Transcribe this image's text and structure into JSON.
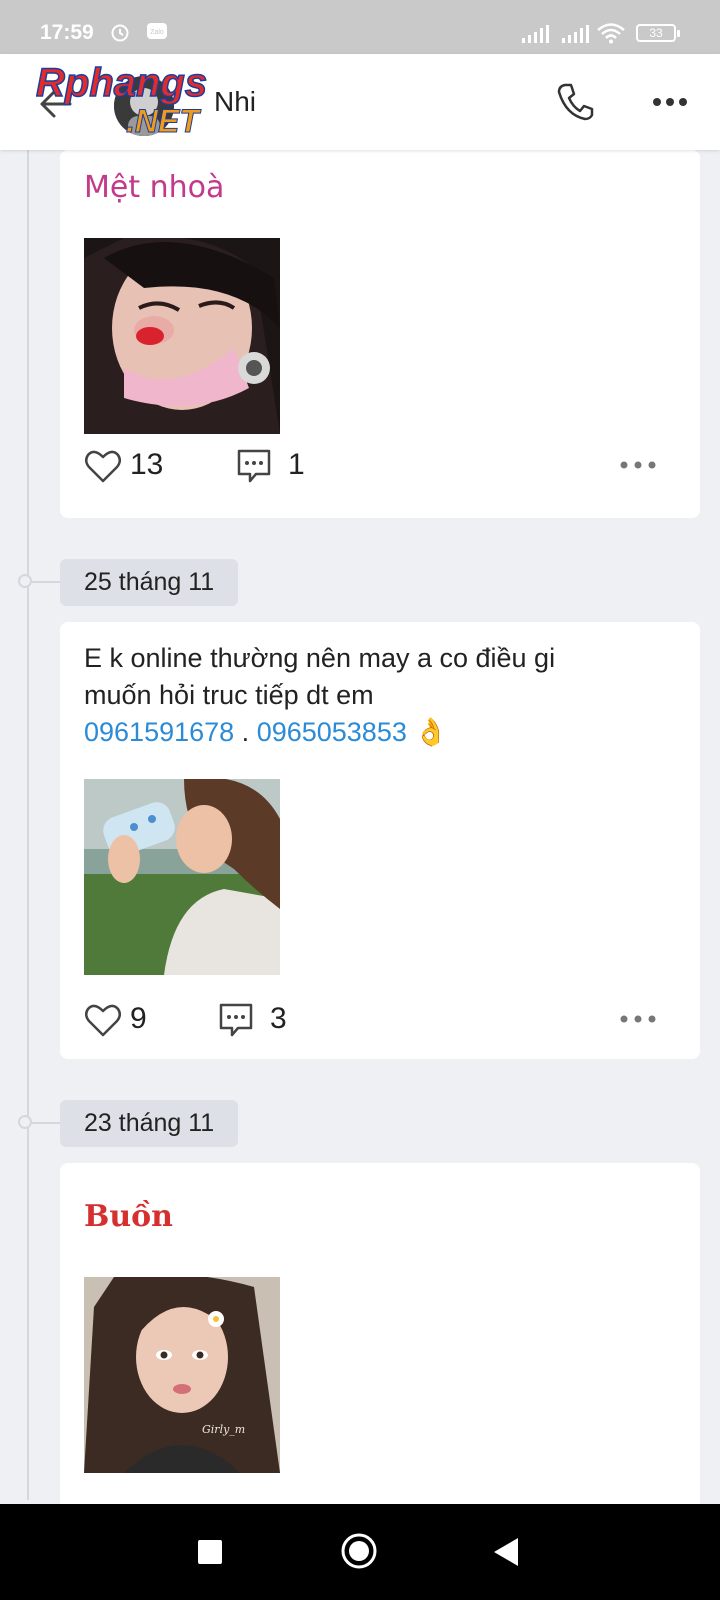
{
  "status_bar": {
    "time": "17:59",
    "zalo_label": "Zalo",
    "battery": "33"
  },
  "header": {
    "name": "Nhi",
    "watermark_text": "Rphangs.NET"
  },
  "timeline": [
    {
      "date": "",
      "title": "Mệt nhoà",
      "likes": "13",
      "comments": "1"
    },
    {
      "date": "25 tháng 11",
      "text_line1": "E k online thường nên may a co điều gi",
      "text_line2": "muốn hỏi truc tiếp dt em",
      "phone1": "0961591678",
      "separator": " . ",
      "phone2": "0965053853",
      "emoji": "👌",
      "likes": "9",
      "comments": "3"
    },
    {
      "date": "23 tháng 11",
      "title": "Buồn",
      "photo_caption": "Girly_m"
    }
  ],
  "colors": {
    "accent_blue": "#2b8bd6",
    "title_pink": "#c43a8b",
    "title_red": "#d52f2f",
    "background": "#eef0f4"
  }
}
